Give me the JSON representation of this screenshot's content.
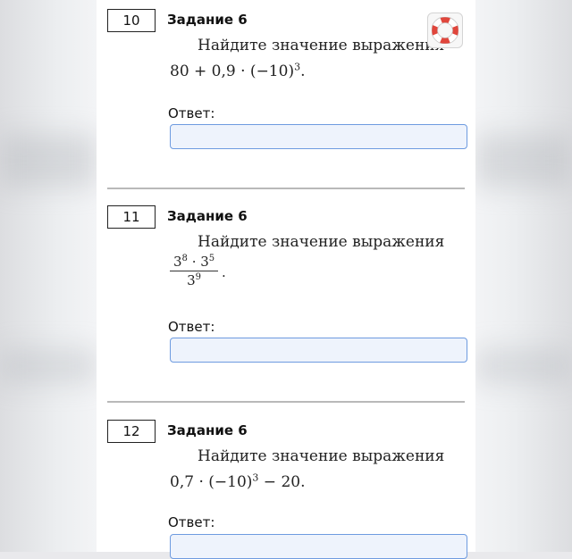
{
  "tasks": [
    {
      "number": "10",
      "title": "Задание 6",
      "prompt": "Найдите значение выражения",
      "expression": {
        "a": "80 + 0,9 · (−10)",
        "exp": "3",
        "end": "."
      },
      "answer_label": "Ответ:",
      "answer_value": ""
    },
    {
      "number": "11",
      "title": "Задание 6",
      "prompt": "Найдите значение выражения",
      "fraction": {
        "n1": "3",
        "e1": "8",
        "dot": " · ",
        "n2": "3",
        "e2": "5",
        "d": "3",
        "ed": "9",
        "end": "."
      },
      "answer_label": "Ответ:",
      "answer_value": ""
    },
    {
      "number": "12",
      "title": "Задание 6",
      "prompt": "Найдите значение выражения",
      "expression": {
        "a": "0,7 · (−10)",
        "exp": "3",
        "end": " − 20."
      },
      "answer_label": "Ответ:",
      "answer_value": ""
    }
  ],
  "help_icon": "lifebuoy-icon",
  "colors": {
    "input_border": "#6e9be0",
    "input_bg": "#eef3fc",
    "lifebuoy_red": "#e0463c"
  }
}
